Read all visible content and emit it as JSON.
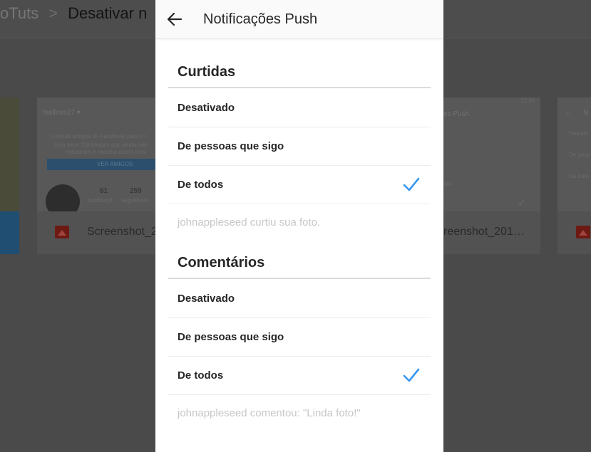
{
  "background": {
    "breadcrumb": {
      "parent": "oTuts",
      "separator": ">",
      "current": "Desativar n"
    },
    "files": [
      {
        "name": "Screenshot_2",
        "label_in_thumb": "fsallees27 ▾"
      },
      {
        "name": "reenshot_201…"
      }
    ],
    "thumb_texts": {
      "invite": "Convide amigos do Facebook para o I",
      "invite_sub": "Veja seus 118 amigos que ainda não",
      "invite_sub2": "Instagram e escolha quem conv",
      "btn": "VER AMIGOS",
      "stat1": "61",
      "stat1_label": "publicaçõ",
      "stat2": "259",
      "stat2_label": "seguidores",
      "right_header": "es Push",
      "right_item": "igo",
      "right_time": "12:36",
      "far_right_n": "N",
      "far_right_items": [
        "Desativ",
        "De pess",
        "De todo"
      ]
    }
  },
  "screen": {
    "title": "Notificações Push",
    "sections": [
      {
        "title": "Curtidas",
        "options": [
          {
            "label": "Desativado",
            "selected": false
          },
          {
            "label": "De pessoas que sigo",
            "selected": false
          },
          {
            "label": "De todos",
            "selected": true
          }
        ],
        "preview": "johnappleseed curtiu sua foto."
      },
      {
        "title": "Comentários",
        "options": [
          {
            "label": "Desativado",
            "selected": false
          },
          {
            "label": "De pessoas que sigo",
            "selected": false
          },
          {
            "label": "De todos",
            "selected": true
          }
        ],
        "preview": "johnappleseed comentou: \"Linda foto!\""
      }
    ]
  },
  "colors": {
    "check": "#3897f0",
    "text": "#262626",
    "preview_text": "#c7c7c7",
    "overlay": "#4a4a4a"
  }
}
